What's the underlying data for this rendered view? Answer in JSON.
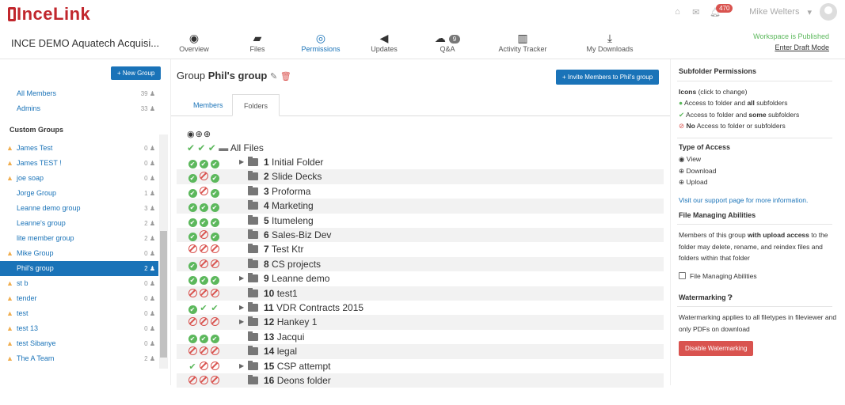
{
  "brand": {
    "logo_text": "InceLink"
  },
  "topbar": {
    "notif_count": "470",
    "user": "Mike Welters",
    "user_caret": "▾"
  },
  "workspace": {
    "title": "INCE DEMO Aquatech Acquisi...",
    "published": "Workspace is Published",
    "draft_link": "Enter Draft Mode"
  },
  "nav": [
    {
      "label": "Overview",
      "icon": "compass-icon"
    },
    {
      "label": "Files",
      "icon": "folder-open-icon"
    },
    {
      "label": "Permissions",
      "icon": "eye-icon"
    },
    {
      "label": "Updates",
      "icon": "megaphone-icon"
    },
    {
      "label": "Q&A",
      "icon": "comments-icon",
      "badge": "9"
    },
    {
      "label": "Activity Tracker",
      "icon": "bar-chart-icon"
    },
    {
      "label": "My Downloads",
      "icon": "download-icon"
    }
  ],
  "sidebar": {
    "new_group": "+ New Group",
    "all_members": {
      "name": "All Members",
      "count": "39"
    },
    "admins": {
      "name": "Admins",
      "count": "33"
    },
    "custom_groups_label": "Custom Groups",
    "groups": [
      {
        "name": "James Test",
        "count": "0",
        "warn": true
      },
      {
        "name": "James TEST !",
        "count": "0",
        "warn": true
      },
      {
        "name": "joe soap",
        "count": "0",
        "warn": true
      },
      {
        "name": "Jorge Group",
        "count": "1",
        "warn": false
      },
      {
        "name": "Leanne demo group",
        "count": "3",
        "warn": false
      },
      {
        "name": "Leanne's group",
        "count": "2",
        "warn": false
      },
      {
        "name": "lite member group",
        "count": "2",
        "warn": false
      },
      {
        "name": "Mike Group",
        "count": "0",
        "warn": true
      },
      {
        "name": "Phil's group",
        "count": "2",
        "warn": false,
        "active": true
      },
      {
        "name": "st b",
        "count": "0",
        "warn": true
      },
      {
        "name": "tender",
        "count": "0",
        "warn": true
      },
      {
        "name": "test",
        "count": "0",
        "warn": true
      },
      {
        "name": "test 13",
        "count": "0",
        "warn": true
      },
      {
        "name": "test Sibanye",
        "count": "0",
        "warn": true
      },
      {
        "name": "The A Team",
        "count": "2",
        "warn": true
      }
    ]
  },
  "main": {
    "group_prefix": "Group",
    "group_name": "Phil's group",
    "invite": "+ Invite Members to Phil's group",
    "tabs": [
      "Members",
      "Folders"
    ],
    "all_files": "All Files",
    "folders": [
      {
        "num": "1",
        "name": "Initial Folder",
        "perms": [
          "full",
          "full",
          "full"
        ],
        "expand": true
      },
      {
        "num": "2",
        "name": "Slide Decks",
        "perms": [
          "full",
          "none",
          "full"
        ],
        "expand": false
      },
      {
        "num": "3",
        "name": "Proforma",
        "perms": [
          "full",
          "none",
          "full"
        ],
        "expand": false
      },
      {
        "num": "4",
        "name": "Marketing",
        "perms": [
          "full",
          "full",
          "full"
        ],
        "expand": false
      },
      {
        "num": "5",
        "name": "Itumeleng",
        "perms": [
          "full",
          "full",
          "full"
        ],
        "expand": false
      },
      {
        "num": "6",
        "name": "Sales-Biz Dev",
        "perms": [
          "full",
          "none",
          "full"
        ],
        "expand": false
      },
      {
        "num": "7",
        "name": "Test Ktr",
        "perms": [
          "none",
          "none",
          "none"
        ],
        "expand": false
      },
      {
        "num": "8",
        "name": "CS projects",
        "perms": [
          "full",
          "none",
          "none"
        ],
        "expand": false
      },
      {
        "num": "9",
        "name": "Leanne demo",
        "perms": [
          "full",
          "full",
          "full"
        ],
        "expand": true
      },
      {
        "num": "10",
        "name": "test1",
        "perms": [
          "none",
          "none",
          "none"
        ],
        "expand": false
      },
      {
        "num": "11",
        "name": "VDR Contracts 2015",
        "perms": [
          "full",
          "some",
          "some"
        ],
        "expand": true
      },
      {
        "num": "12",
        "name": "Hankey 1",
        "perms": [
          "none",
          "none",
          "none"
        ],
        "expand": true
      },
      {
        "num": "13",
        "name": "Jacqui",
        "perms": [
          "full",
          "full",
          "full"
        ],
        "expand": false
      },
      {
        "num": "14",
        "name": "legal",
        "perms": [
          "none",
          "none",
          "none"
        ],
        "expand": false
      },
      {
        "num": "15",
        "name": "CSP attempt",
        "perms": [
          "some",
          "none",
          "none"
        ],
        "expand": true
      },
      {
        "num": "16",
        "name": "Deons folder",
        "perms": [
          "none",
          "none",
          "none"
        ],
        "expand": false
      }
    ]
  },
  "panel": {
    "title": "Subfolder Permissions",
    "icons_label": "Icons",
    "icons_hint": "(click to change)",
    "legend_all_pre": "Access to folder and ",
    "legend_all_b": "all",
    "legend_all_post": " subfolders",
    "legend_some_pre": "Access to folder and ",
    "legend_some_b": "some",
    "legend_some_post": " subfolders",
    "legend_none_b": "No",
    "legend_none_post": " Access to folder or subfolders",
    "type_title": "Type of Access",
    "type_view": "View",
    "type_download": "Download",
    "type_upload": "Upload",
    "support": "Visit our support page for more information.",
    "fma_title": "File Managing Abilities",
    "fma_text_1": "Members of this group ",
    "fma_text_b": "with upload access",
    "fma_text_2": " to the folder may delete, rename, and reindex files and folders within that folder",
    "fma_checkbox": "File Managing Abilities",
    "wm_title": "Watermarking",
    "wm_text": "Watermarking applies to all filetypes in fileviewer and only PDFs on download",
    "wm_button": "Disable Watermarking"
  }
}
